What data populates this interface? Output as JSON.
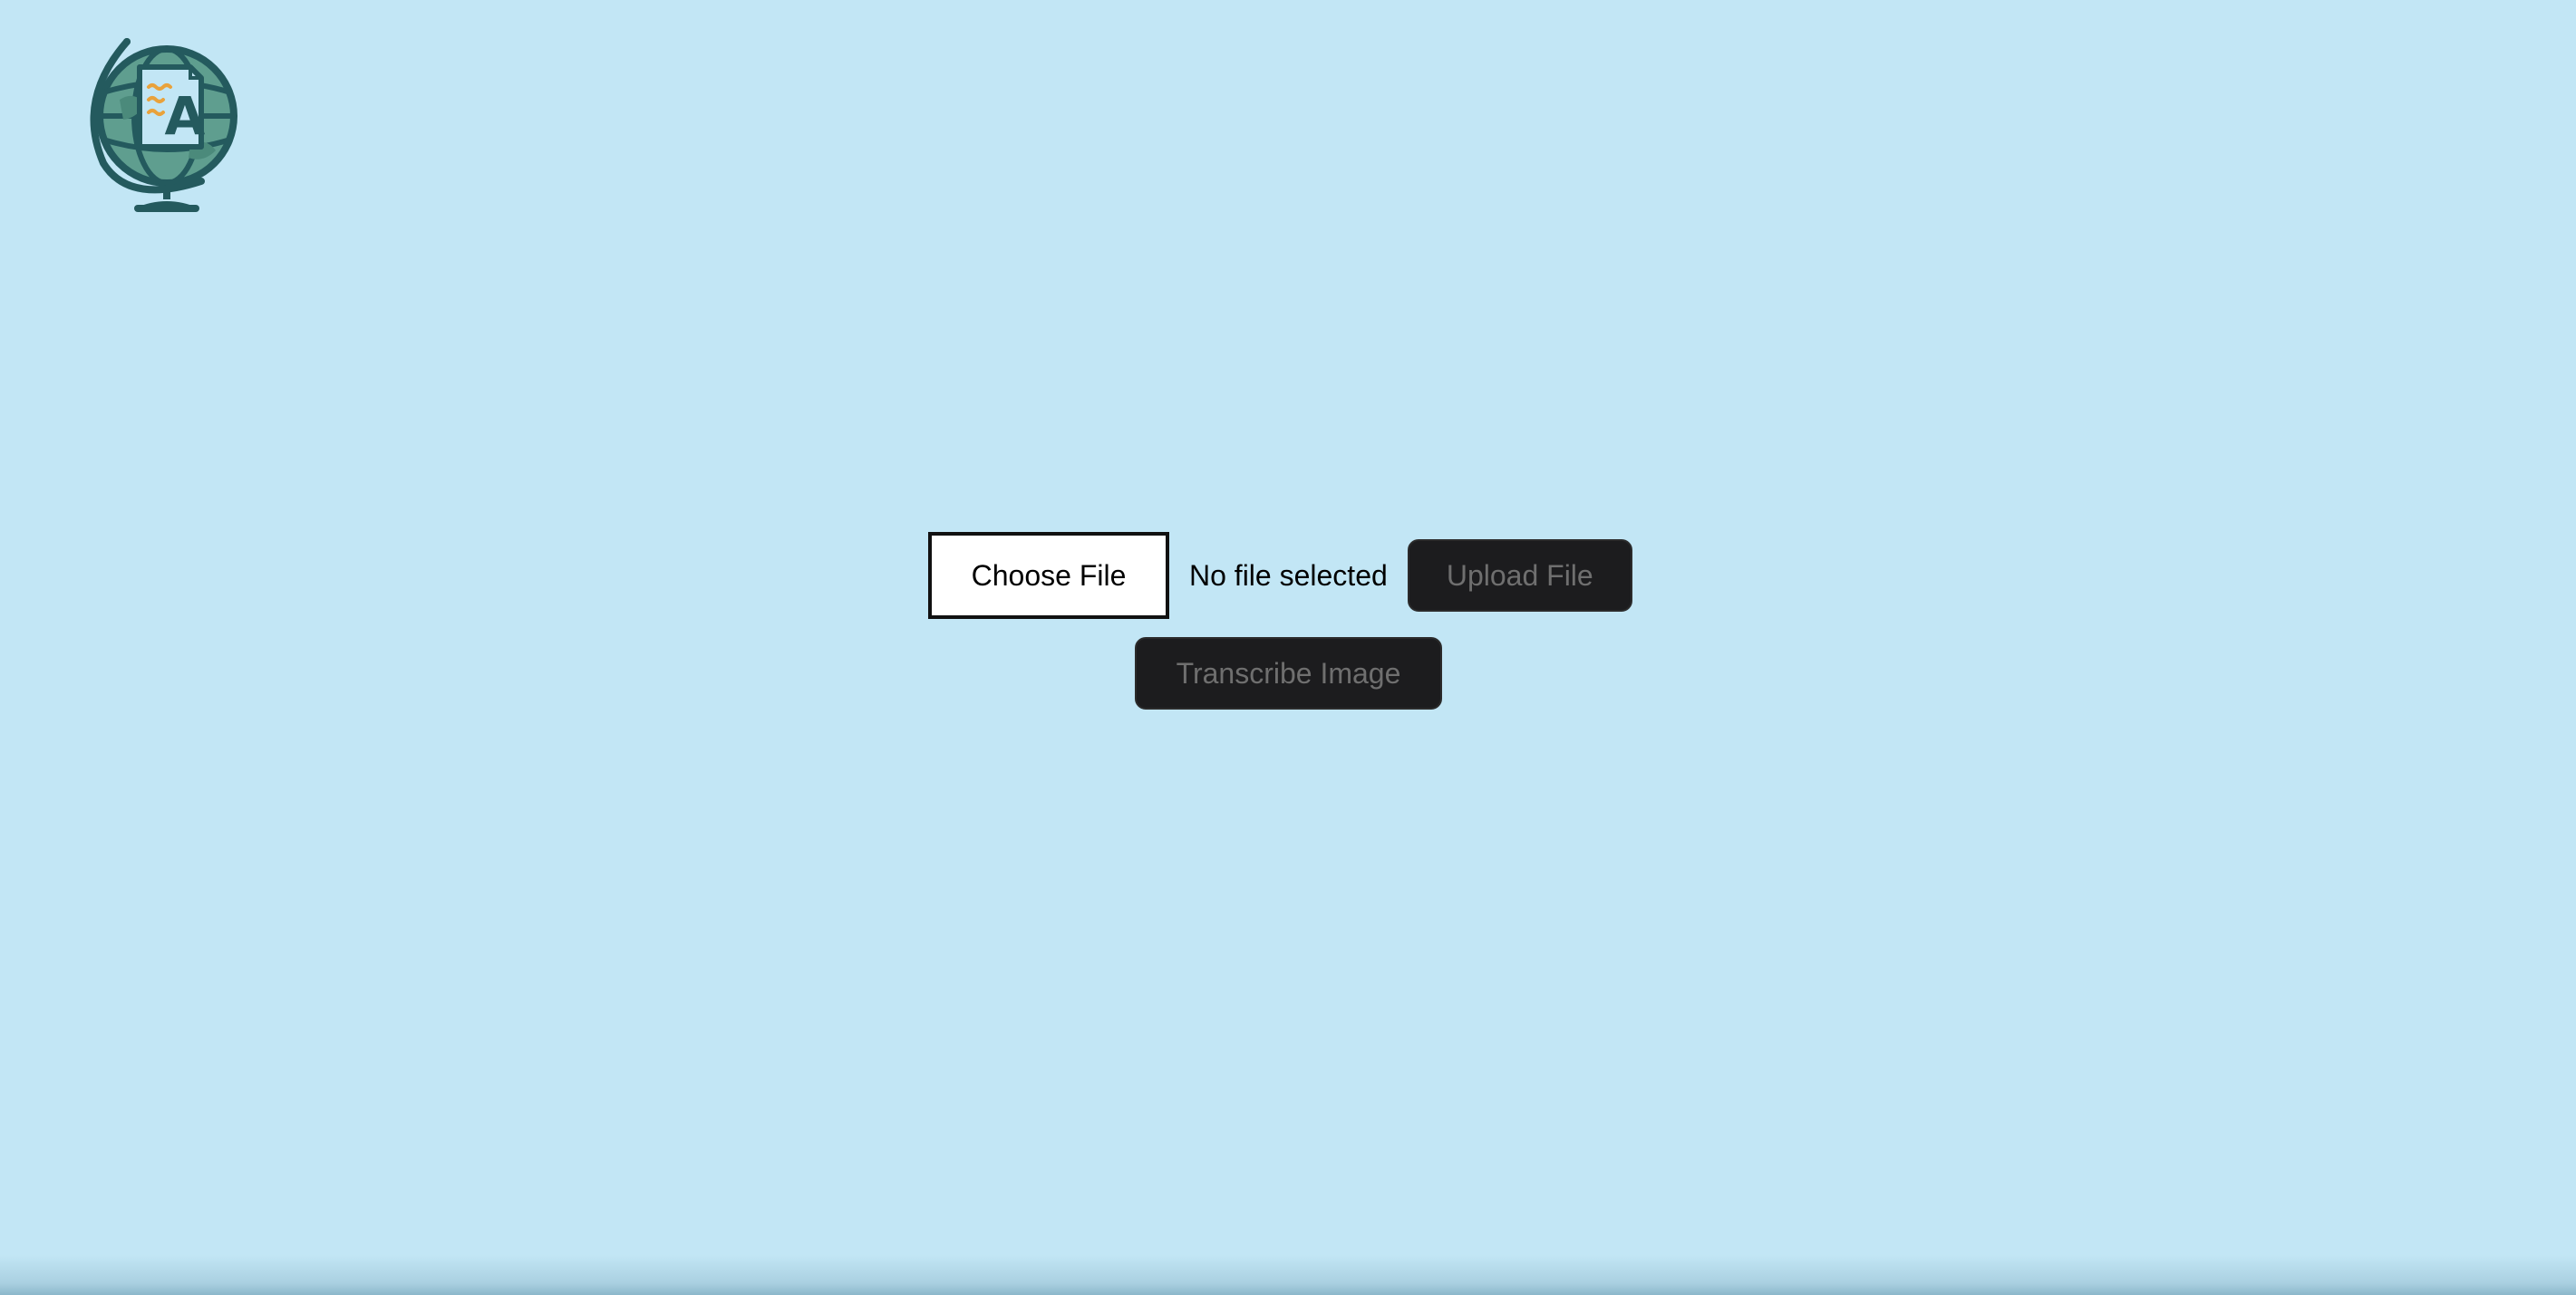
{
  "logo": {
    "icon": "globe-document-icon",
    "letter": "A",
    "colors": {
      "outline": "#245a5e",
      "globe_fill": "#5f9e8f",
      "document": "#c2e6f5",
      "accent": "#e9a23b"
    }
  },
  "uploader": {
    "choose_file_label": "Choose File",
    "file_status": "No file selected",
    "upload_button_label": "Upload File"
  },
  "actions": {
    "transcribe_button_label": "Transcribe Image"
  },
  "colors": {
    "background": "#c2e6f5",
    "button_dark": "#1c1c1e",
    "button_disabled_text": "#6f6f6f"
  }
}
